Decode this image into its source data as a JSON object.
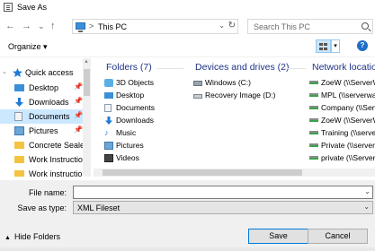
{
  "title": "Save As",
  "address": {
    "separator": ">",
    "location": "This PC"
  },
  "search": {
    "placeholder": "Search This PC"
  },
  "toolbar": {
    "organize_label": "Organize",
    "organize_caret": "▾",
    "help_label": "?"
  },
  "nav_buttons": {
    "back": "←",
    "forward": "→",
    "dropdown": "⌄",
    "up": "↑"
  },
  "navpane": {
    "items": [
      {
        "label": "Quick access",
        "icon": "star-icon",
        "pinned": false
      },
      {
        "label": "Desktop",
        "icon": "desktop-folder-icon",
        "pinned": true
      },
      {
        "label": "Downloads",
        "icon": "downloads-icon",
        "pinned": true
      },
      {
        "label": "Documents",
        "icon": "documents-icon",
        "pinned": true,
        "selected": true
      },
      {
        "label": "Pictures",
        "icon": "pictures-icon",
        "pinned": true
      },
      {
        "label": "Concrete Sealer",
        "icon": "folder-icon",
        "pinned": false
      },
      {
        "label": "Work Instruction",
        "icon": "folder-icon",
        "pinned": false
      },
      {
        "label": "Work instruction",
        "icon": "folder-icon",
        "pinned": false
      }
    ]
  },
  "content": {
    "folders": {
      "heading": "Folders (7)",
      "items": [
        "3D Objects",
        "Desktop",
        "Documents",
        "Downloads",
        "Music",
        "Pictures",
        "Videos"
      ]
    },
    "drives": {
      "heading": "Devices and drives (2)",
      "items": [
        "Windows (C:)",
        "Recovery Image (D:)"
      ]
    },
    "network": {
      "heading": "Network locatio",
      "items": [
        "ZoeW (\\\\ServerW",
        "MPL (\\\\serverwa",
        "Company (\\\\Serve",
        "ZoeW (\\\\ServerW",
        "Training (\\\\serve",
        "Private (\\\\server",
        "private (\\\\Server"
      ]
    }
  },
  "fields": {
    "file_name_label": "File name:",
    "file_name_value": "",
    "save_type_label": "Save as type:",
    "save_type_value": "XML Fileset"
  },
  "footer": {
    "hide_folders_label": "Hide Folders",
    "save_label": "Save",
    "cancel_label": "Cancel"
  },
  "colors": {
    "accent": "#0078d7",
    "heading": "#1e3287",
    "selected_bg": "#cce8ff"
  }
}
